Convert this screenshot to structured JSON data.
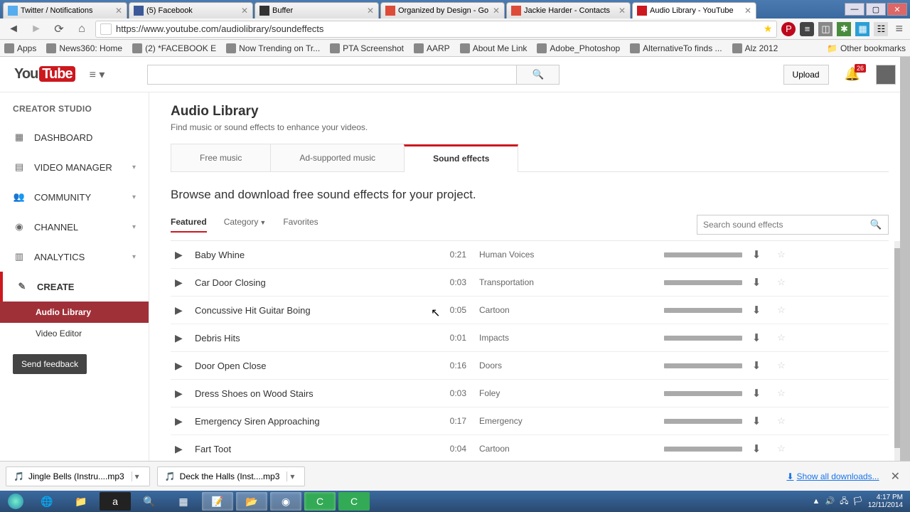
{
  "browser": {
    "tabs": [
      {
        "label": "Twitter / Notifications",
        "icon": "#55acee"
      },
      {
        "label": "(5) Facebook",
        "icon": "#3b5998"
      },
      {
        "label": "Buffer",
        "icon": "#333333"
      },
      {
        "label": "Organized by Design - Go",
        "icon": "#dd4b39"
      },
      {
        "label": "Jackie Harder - Contacts",
        "icon": "#dd4b39"
      },
      {
        "label": "Audio Library - YouTube",
        "icon": "#cc181e",
        "active": true
      }
    ],
    "url": "https://www.youtube.com/audiolibrary/soundeffects",
    "bookmarks": [
      "Apps",
      "News360: Home",
      "(2) *FACEBOOK E",
      "Now Trending on Tr...",
      "PTA Screenshot",
      "AARP",
      "About Me Link",
      "Adobe_Photoshop",
      "AlternativeTo finds ...",
      "Alz 2012"
    ],
    "other_bookmarks": "Other bookmarks"
  },
  "masthead": {
    "upload": "Upload",
    "notification_count": "26"
  },
  "sidebar": {
    "title": "CREATOR STUDIO",
    "items": [
      {
        "label": "DASHBOARD",
        "icon": "▦"
      },
      {
        "label": "VIDEO MANAGER",
        "icon": "▤",
        "expandable": true
      },
      {
        "label": "COMMUNITY",
        "icon": "👥",
        "expandable": true
      },
      {
        "label": "CHANNEL",
        "icon": "◉",
        "expandable": true
      },
      {
        "label": "ANALYTICS",
        "icon": "▥",
        "expandable": true
      },
      {
        "label": "CREATE",
        "icon": "✎",
        "create": true
      }
    ],
    "subs": [
      {
        "label": "Audio Library",
        "active": true
      },
      {
        "label": "Video Editor"
      }
    ],
    "feedback": "Send feedback"
  },
  "content": {
    "title": "Audio Library",
    "subtitle": "Find music or sound effects to enhance your videos.",
    "tabs": [
      "Free music",
      "Ad-supported music",
      "Sound effects"
    ],
    "active_tab": 2,
    "browse": "Browse and download free sound effects for your project.",
    "filters": [
      "Featured",
      "Category",
      "Favorites"
    ],
    "active_filter": 0,
    "search_placeholder": "Search sound effects",
    "tracks": [
      {
        "title": "Baby Whine",
        "dur": "0:21",
        "cat": "Human Voices"
      },
      {
        "title": "Car Door Closing",
        "dur": "0:03",
        "cat": "Transportation"
      },
      {
        "title": "Concussive Hit Guitar Boing",
        "dur": "0:05",
        "cat": "Cartoon"
      },
      {
        "title": "Debris Hits",
        "dur": "0:01",
        "cat": "Impacts"
      },
      {
        "title": "Door Open Close",
        "dur": "0:16",
        "cat": "Doors"
      },
      {
        "title": "Dress Shoes on Wood Stairs",
        "dur": "0:03",
        "cat": "Foley"
      },
      {
        "title": "Emergency Siren Approaching",
        "dur": "0:17",
        "cat": "Emergency"
      },
      {
        "title": "Fart Toot",
        "dur": "0:04",
        "cat": "Cartoon"
      }
    ]
  },
  "downloads": {
    "items": [
      "Jingle Bells (Instru....mp3",
      "Deck the Halls (Inst....mp3"
    ],
    "show_all": "Show all downloads..."
  },
  "taskbar": {
    "time": "4:17 PM",
    "date": "12/11/2014"
  }
}
